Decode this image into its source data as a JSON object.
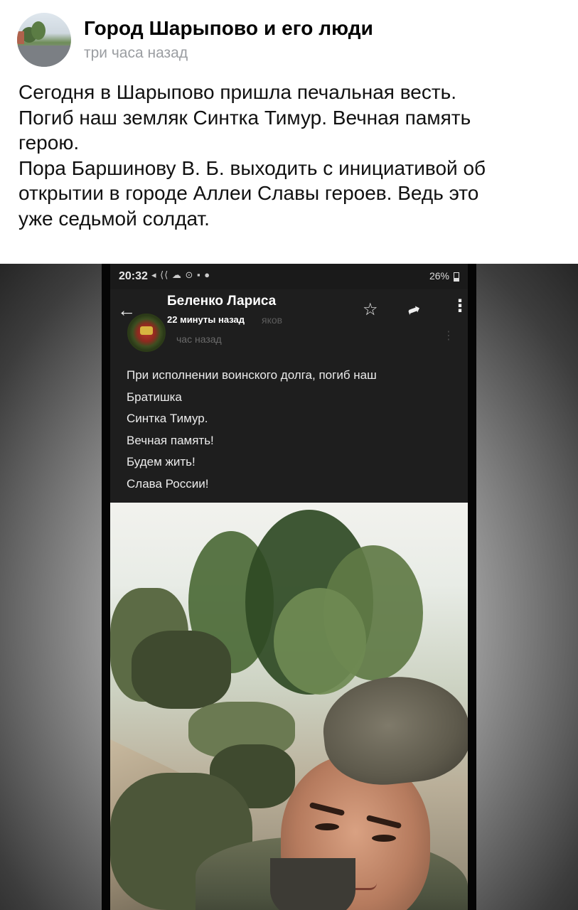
{
  "post": {
    "group_name": "Город Шарыпово и его люди",
    "time": "три часа назад",
    "text_lines": [
      "Сегодня в Шарыпово пришла печальная весть.",
      "Погиб наш земляк Синтка Тимур. Вечная память",
      "герою.",
      "Пора Баршинову В. Б. выходить с инициативой об",
      "открытии в городе Аллеи Славы  героев. Ведь это",
      "уже седьмой солдат."
    ]
  },
  "screenshot": {
    "status_bar": {
      "time": "20:32",
      "battery": "26%"
    },
    "app_bar": {
      "author_name": "Беленко Лариса",
      "author_time": "22 минуты назад",
      "ghost_name_fragment": "яков",
      "ghost_time": "час назад",
      "back_icon": "arrow-left-icon",
      "star_icon": "star-outline-icon",
      "share_icon": "share-arrow-icon",
      "menu_icon": "more-vertical-icon"
    },
    "message_lines": [
      "При исполнении воинского долга, погиб наш",
      "Братишка",
      "Синтка Тимур.",
      "Вечная память!",
      "Будем жить!",
      "Слава России!"
    ]
  },
  "colors": {
    "group_name": "#000000",
    "time": "#9a9da1",
    "screenshot_bg": "#1e1e1e"
  }
}
